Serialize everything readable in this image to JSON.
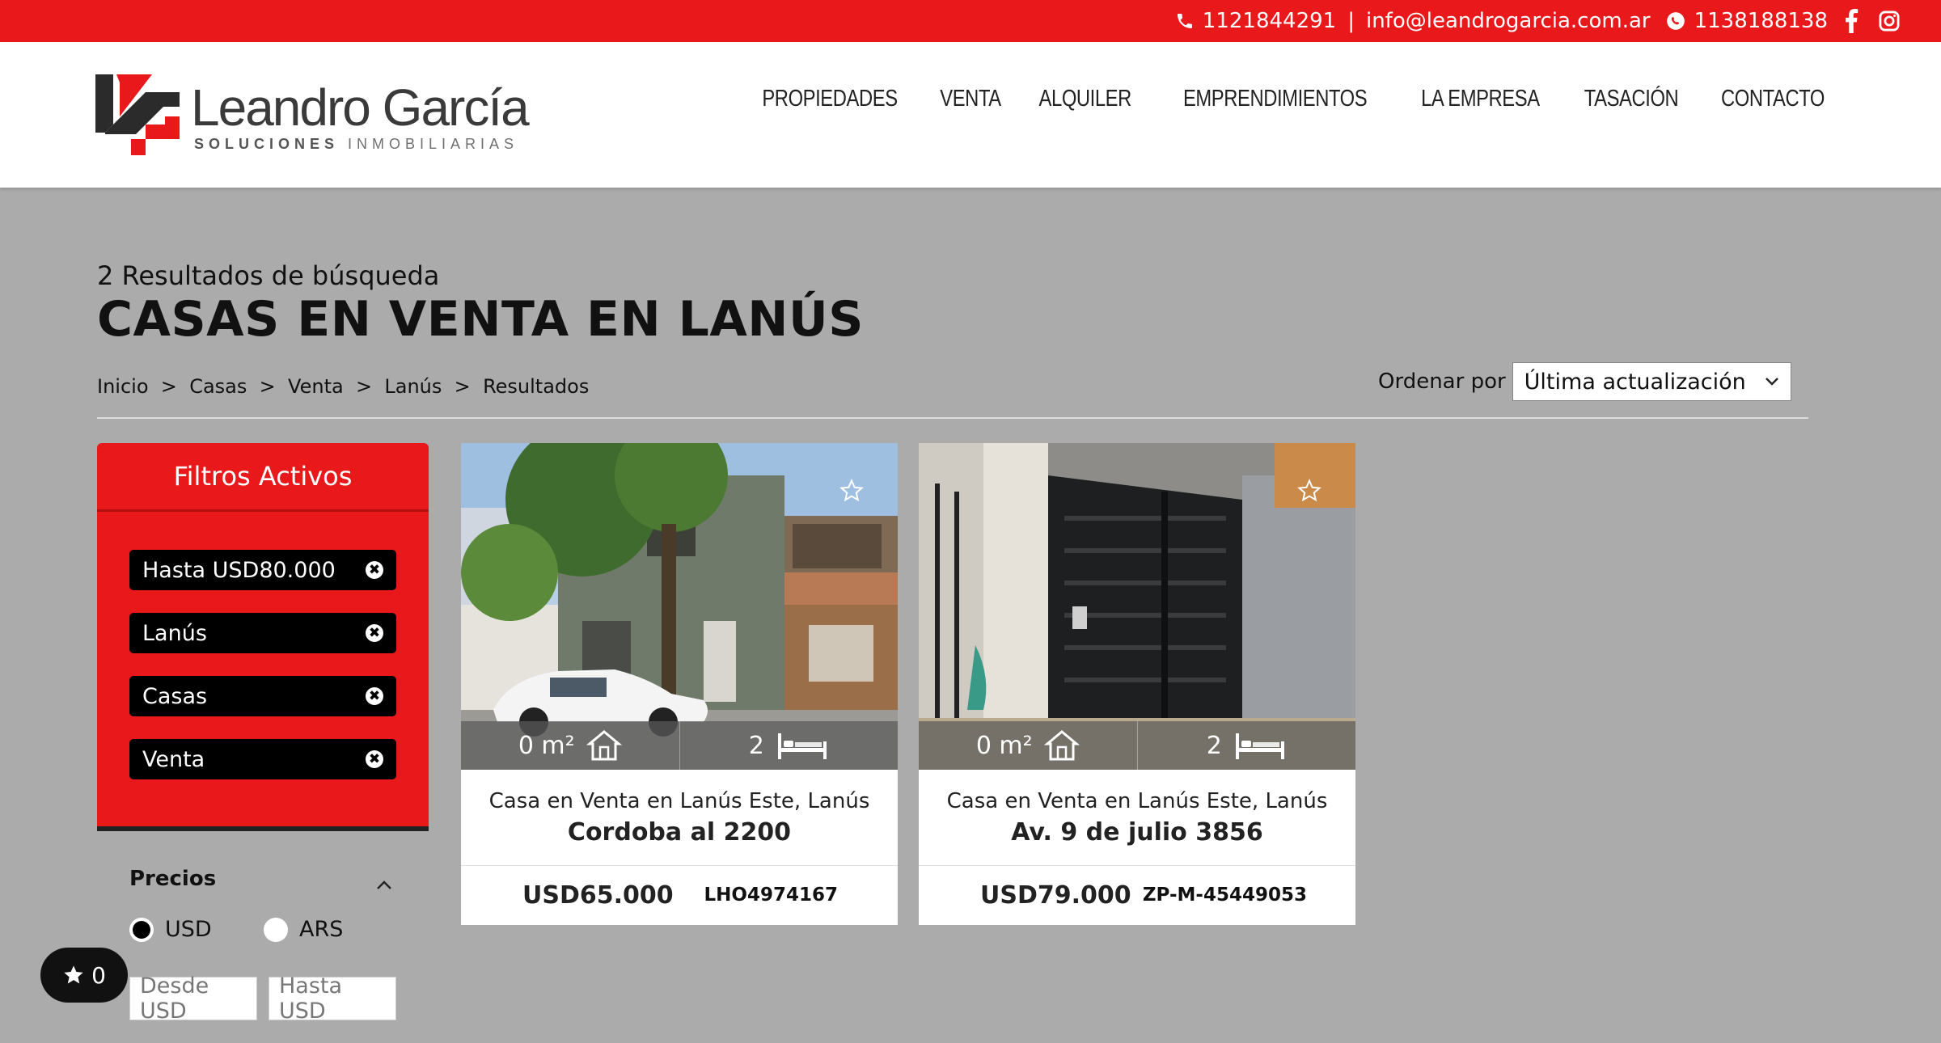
{
  "topbar": {
    "phone": "1121844291",
    "separator": "|",
    "email": "info@leandrogarcia.com.ar",
    "whatsapp": "1138188138",
    "icons": [
      "phone-icon",
      "whatsapp-icon",
      "facebook-icon",
      "instagram-icon"
    ]
  },
  "brand": {
    "name": "Leandro García",
    "tagline_bold": "SOLUCIONES",
    "tagline_rest": "INMOBILIARIAS",
    "colors": {
      "red": "#e8181b",
      "dark": "#3a3a3a"
    }
  },
  "nav": {
    "items": [
      "PROPIEDADES",
      "VENTA",
      "ALQUILER",
      "EMPRENDIMIENTOS",
      "LA EMPRESA",
      "TASACIÓN",
      "CONTACTO"
    ]
  },
  "results": {
    "subtitle": "2 Resultados de búsqueda",
    "title": "CASAS EN VENTA EN LANÚS"
  },
  "breadcrumb": {
    "items": [
      "Inicio",
      "Casas",
      "Venta",
      "Lanús",
      "Resultados"
    ],
    "separator": ">"
  },
  "sort": {
    "label": "Ordenar por",
    "selected": "Última actualización"
  },
  "filters": {
    "title": "Filtros Activos",
    "chips": [
      "Hasta USD80.000",
      "Lanús",
      "Casas",
      "Venta"
    ],
    "remove_icon": "✖"
  },
  "prices": {
    "label": "Precios",
    "currencies": [
      {
        "label": "USD",
        "selected": true
      },
      {
        "label": "ARS",
        "selected": false
      }
    ],
    "from_placeholder": "Desde USD",
    "to_placeholder": "Hasta USD"
  },
  "favorites": {
    "count": "0"
  },
  "cards": [
    {
      "area": "0 m²",
      "bedrooms": "2",
      "location": "Casa en Venta en Lanús Este, Lanús",
      "address": "Cordoba al 2200",
      "price": "USD65.000",
      "code": "LHO4974167"
    },
    {
      "area": "0 m²",
      "bedrooms": "2",
      "location": "Casa en Venta en Lanús Este, Lanús",
      "address": "Av. 9 de julio 3856",
      "price": "USD79.000",
      "code": "ZP-M-45449053"
    }
  ]
}
